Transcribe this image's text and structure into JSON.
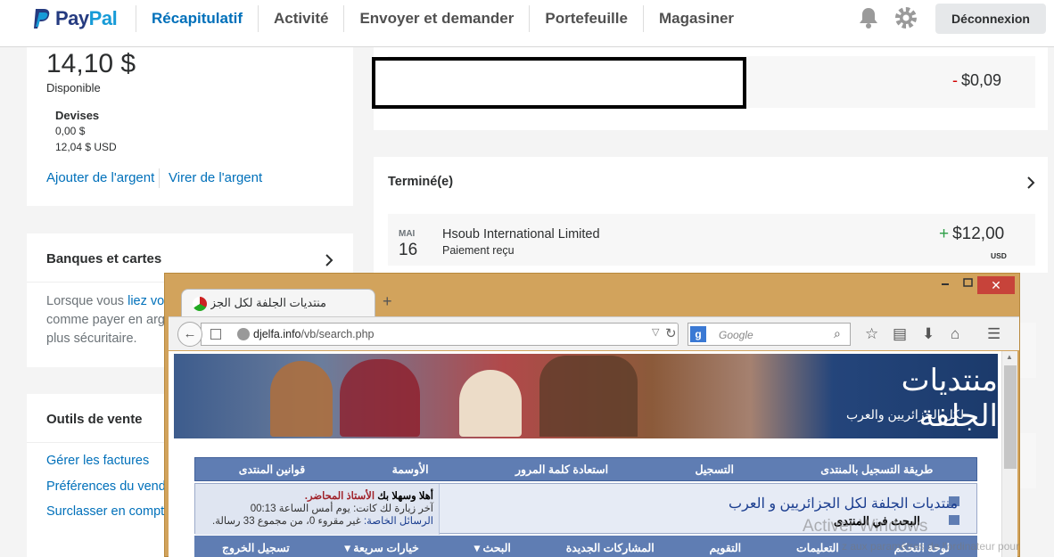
{
  "header": {
    "brand_a": "Pay",
    "brand_b": "Pal",
    "nav": [
      "Récapitulatif",
      "Activité",
      "Envoyer et demander",
      "Portefeuille",
      "Magasiner"
    ],
    "logout": "Déconnexion",
    "accent_color": "#0070ba"
  },
  "balance_card": {
    "amount": "14,10 $",
    "available": "Disponible",
    "currencies_title": "Devises",
    "currency_1": "0,00 $",
    "currency_2": "12,04 $ USD",
    "add_money": "Ajouter de l'argent",
    "withdraw": "Virer de l'argent"
  },
  "banks_card": {
    "title": "Banques et cartes",
    "desc_a": "Lorsque vous ",
    "desc_link": "liez vo",
    "desc_b": "comme payer en arg",
    "desc_c": "plus sécuritaire."
  },
  "tools_card": {
    "title": "Outils de vente",
    "link_1": "Gérer les factures",
    "link_2": "Préférences du vend",
    "link_3": "Surclasser en compt"
  },
  "pending": {
    "amount_sign": "-",
    "amount": "$0,09"
  },
  "completed": {
    "title": "Terminé(e)",
    "month": "MAI",
    "day": "16",
    "merchant": "Hsoub International Limited",
    "status": "Paiement reçu",
    "amount_sign": "+",
    "amount": "$12,00",
    "currency": "USD"
  },
  "browser": {
    "tab_title": "منتديات الجلفة لكل الجزا...",
    "url_domain": "djelfa.info",
    "url_path": "/vb/search.php",
    "search_placeholder": "Google",
    "banner_logo": "منتديات الجلفة",
    "banner_sub": "لكل الجزائريين والعرب",
    "forum_nav": [
      "طريقة التسجيل بالمنتدى",
      "التسجيل",
      "استعادة كلمة المرور",
      "الأوسمة",
      "قوانين المنتدى"
    ],
    "welcome_a": "أهلا وسهلا بك ",
    "welcome_name": "الأستاذ المحاضر.",
    "last_visit": "آخر زيارة لك كانت: يوم أمس الساعة 00:13",
    "pm_label": "الرسائل الخاصة:",
    "pm_text": " غير مقروء 0، من مجموع 33 رسالة.",
    "forum_name": "منتديات الجلفة لكل الجزائريين و العرب",
    "forum_search": "البحث في المنتدى",
    "bottom_nav": [
      "لوحة التحكم",
      "التعليمات",
      "التقويم",
      "المشاركات الجديدة",
      "البحث ▾",
      "خيارات سريعة ▾",
      "تسجيل الخروج"
    ]
  },
  "watermark": {
    "line1": "Activer Windows",
    "line2": "z aux paramètres de l'ordinateur pour"
  }
}
